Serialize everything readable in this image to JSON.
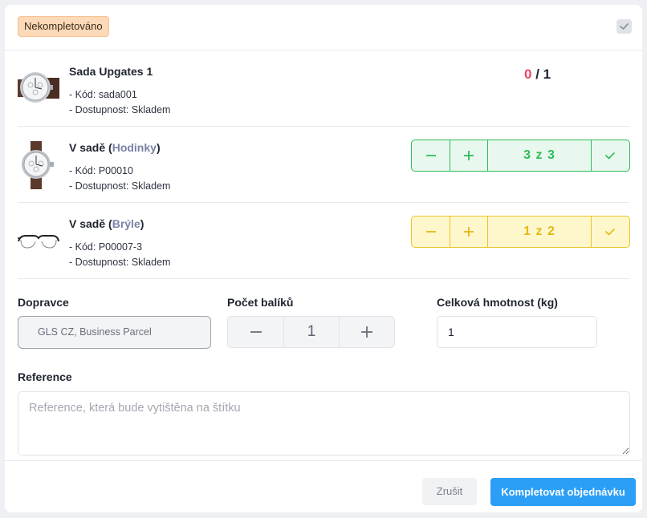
{
  "header": {
    "status": "Nekompletováno"
  },
  "items": [
    {
      "title": "Sada Upgates 1",
      "code_line": "- Kód: sada001",
      "stock_line": "- Dostupnost: Skladem",
      "picked": "0",
      "separator": "/",
      "total": "1"
    },
    {
      "title_prefix": "V sadě (",
      "category": "Hodinky",
      "title_suffix": ")",
      "code_line": "- Kód: P00010",
      "stock_line": "- Dostupnost: Skladem",
      "progress": "3 z 3",
      "state": "complete",
      "color": "#2dbb59"
    },
    {
      "title_prefix": "V sadě (",
      "category": "Brýle",
      "title_suffix": ")",
      "code_line": "- Kód: P00007-3",
      "stock_line": "- Dostupnost: Skladem",
      "progress": "1 z 2",
      "state": "partial",
      "color": "#e8c42a"
    }
  ],
  "form": {
    "carrier_label": "Dopravce",
    "carrier_value": "GLS CZ, Business Parcel",
    "packages_label": "Počet balíků",
    "packages_value": "1",
    "weight_label": "Celková hmotnost (kg)",
    "weight_value": "1",
    "reference_label": "Reference",
    "reference_placeholder": "Reference, která bude vytištěna na štítku"
  },
  "footer": {
    "cancel_label": "Zrušit",
    "complete_label": "Kompletovat objednávku"
  },
  "colors": {
    "primary": "#2b9ff6",
    "success": "#2dbb59",
    "warning": "#e8c42a",
    "danger": "#ef4662",
    "status_badge_bg": "#fcd9b8"
  },
  "icons": [
    "chevron-check-icon",
    "watch-thumbnail",
    "glasses-thumbnail",
    "minus-icon",
    "plus-icon",
    "check-icon"
  ]
}
